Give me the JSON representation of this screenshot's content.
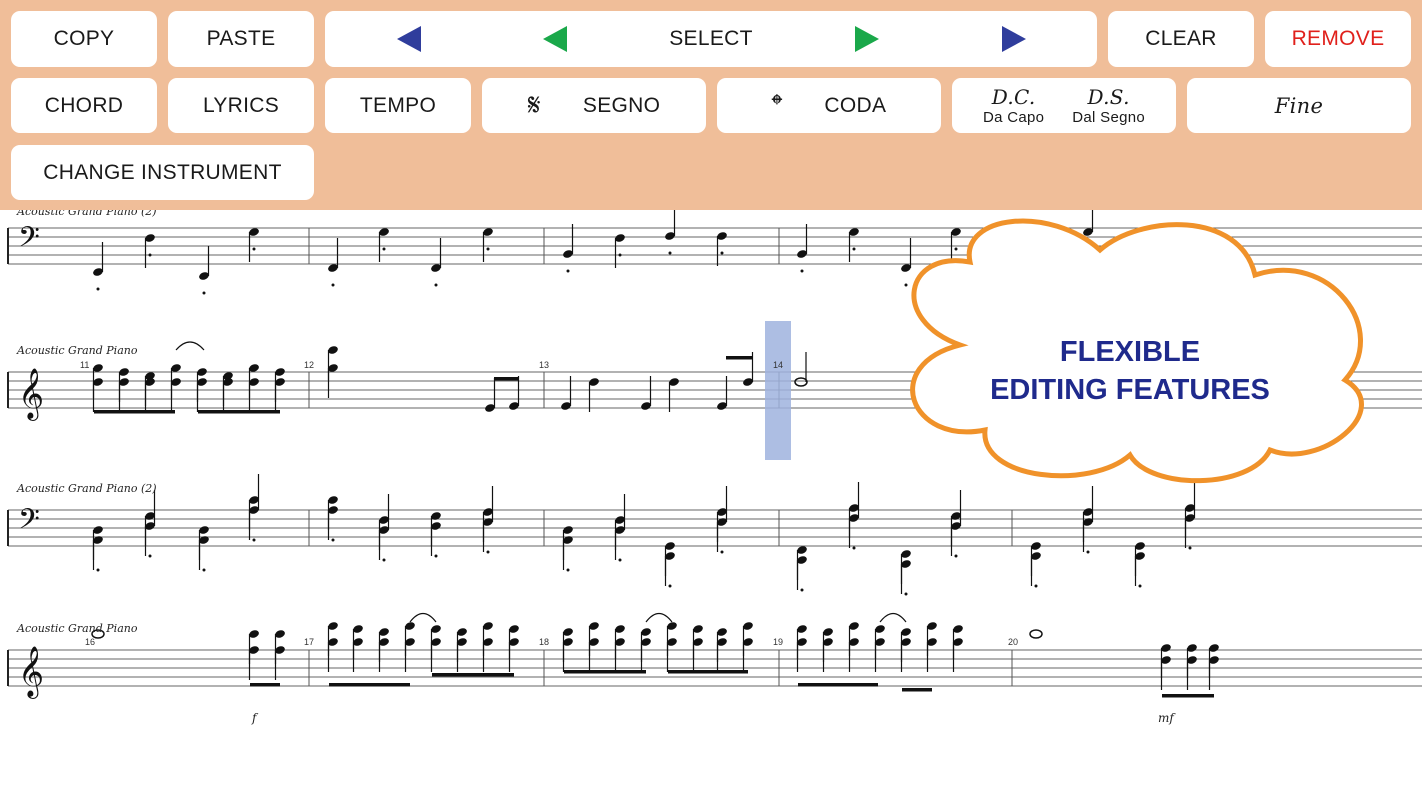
{
  "toolbar": {
    "copy": "COPY",
    "paste": "PASTE",
    "select": "SELECT",
    "clear": "CLEAR",
    "remove": "REMOVE",
    "chord": "CHORD",
    "lyrics": "LYRICS",
    "tempo": "TEMPO",
    "segno": "SEGNO",
    "segno_symbol": "𝄋",
    "coda": "CODA",
    "coda_symbol": "𝄌",
    "dc_abbr": "D.C.",
    "dc_label": "Da Capo",
    "ds_abbr": "D.S.",
    "ds_label": "Dal Segno",
    "fine": "Fine",
    "change_instrument": "CHANGE INSTRUMENT",
    "colors": {
      "background": "#f0be99",
      "remove": "#e0201b",
      "arrow_outer": "#2f3d9c",
      "arrow_inner": "#1aa84a"
    }
  },
  "score": {
    "instruments": {
      "piano": "Acoustic Grand Piano",
      "piano2": "Acoustic Grand Piano (2)"
    },
    "measure_numbers": [
      "11",
      "12",
      "13",
      "14",
      "16",
      "17",
      "18",
      "19",
      "20"
    ],
    "selected_measure": "14",
    "dynamics": [
      "f",
      "mf"
    ],
    "selection_color": "#9fb3de"
  },
  "banner": {
    "line1": "FLEXIBLE",
    "line2": "EDITING FEATURES",
    "outline_color": "#f0922a",
    "text_color": "#1f2a8c"
  }
}
